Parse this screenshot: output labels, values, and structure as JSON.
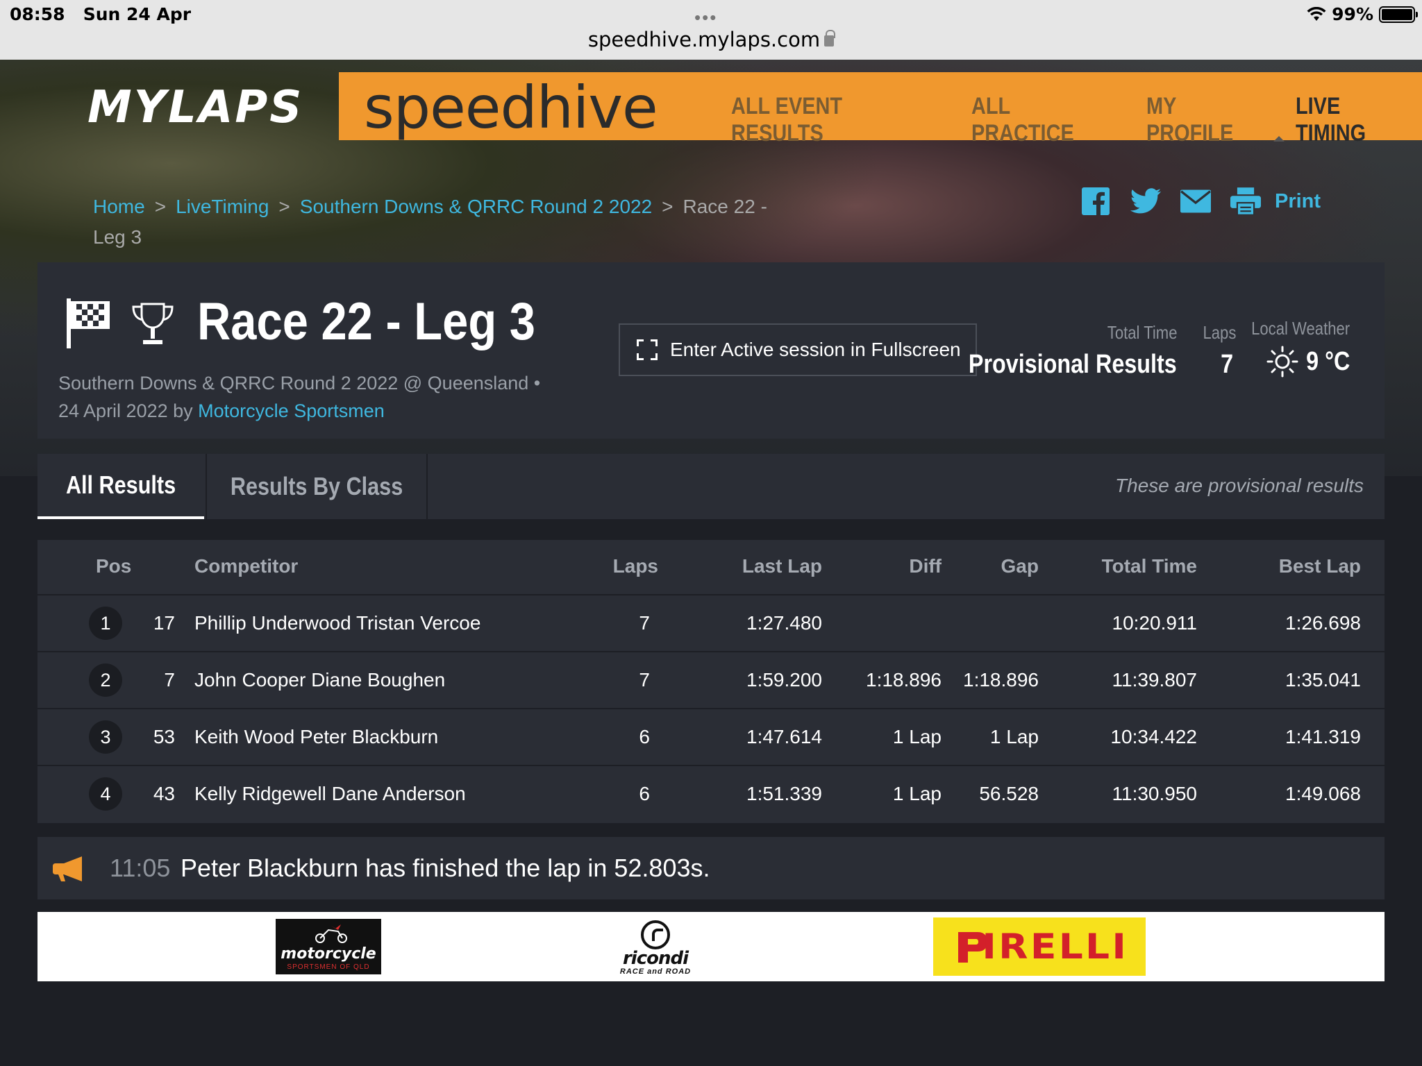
{
  "status_bar": {
    "time": "08:58",
    "date": "Sun 24 Apr",
    "dots": "•••",
    "url": "speedhive.mylaps.com",
    "battery": "99%",
    "battery_level": 0.99
  },
  "header": {
    "logo": "MYLAPS",
    "brand": "speedhive",
    "nav": [
      "ALL EVENT RESULTS",
      "ALL PRACTICE",
      "MY PROFILE",
      "LIVE TIMING"
    ],
    "active_nav": "LIVE TIMING",
    "accent_color": "#f0982e"
  },
  "breadcrumb": {
    "items": [
      "Home",
      "LiveTiming",
      "Southern Downs & QRRC Round 2 2022"
    ],
    "current": "Race 22 - Leg 3"
  },
  "share": {
    "icons": [
      "facebook-icon",
      "twitter-icon",
      "email-icon",
      "print-icon"
    ],
    "print_label": "Print"
  },
  "session": {
    "title": "Race 22 - Leg 3",
    "subtitle_line1": "Southern Downs & QRRC Round 2 2022 @ Queensland •",
    "subtitle_date": "24 April 2022 by ",
    "organizer": "Motorcycle Sportsmen",
    "fullscreen_label": "Enter Active session in Fullscreen",
    "total_time_label": "Total Time",
    "total_time_value": "Provisional Results",
    "laps_label": "Laps",
    "laps_value": "7",
    "weather_label": "Local Weather",
    "weather_value": "9 °C"
  },
  "tabs": {
    "items": [
      "All Results",
      "Results By Class"
    ],
    "active": "All Results",
    "note": "These are provisional results"
  },
  "results": {
    "columns": [
      "Pos",
      "Competitor",
      "Laps",
      "Last Lap",
      "Diff",
      "Gap",
      "Total Time",
      "Best Lap"
    ],
    "rows": [
      {
        "pos": "1",
        "num": "17",
        "competitor": "Phillip Underwood Tristan Vercoe",
        "laps": "7",
        "last_lap": "1:27.480",
        "diff": "",
        "gap": "",
        "total_time": "10:20.911",
        "best_lap": "1:26.698"
      },
      {
        "pos": "2",
        "num": "7",
        "competitor": "John Cooper Diane Boughen",
        "laps": "7",
        "last_lap": "1:59.200",
        "diff": "1:18.896",
        "gap": "1:18.896",
        "total_time": "11:39.807",
        "best_lap": "1:35.041"
      },
      {
        "pos": "3",
        "num": "53",
        "competitor": "Keith Wood Peter Blackburn",
        "laps": "6",
        "last_lap": "1:47.614",
        "diff": "1 Lap",
        "gap": "1 Lap",
        "total_time": "10:34.422",
        "best_lap": "1:41.319"
      },
      {
        "pos": "4",
        "num": "43",
        "competitor": "Kelly Ridgewell Dane Anderson",
        "laps": "6",
        "last_lap": "1:51.339",
        "diff": "1 Lap",
        "gap": "56.528",
        "total_time": "11:30.950",
        "best_lap": "1:49.068"
      }
    ]
  },
  "ticker": {
    "time": "11:05",
    "message": "Peter Blackburn has finished the lap in 52.803s."
  },
  "sponsors": {
    "motorcycle_sportsmen": {
      "name": "motorcycle",
      "sub": "SPORTSMEN OF QLD"
    },
    "ricondi": {
      "name": "ricondi",
      "sub": "RACE and ROAD"
    },
    "pirelli": {
      "name": "IRELLI"
    }
  }
}
